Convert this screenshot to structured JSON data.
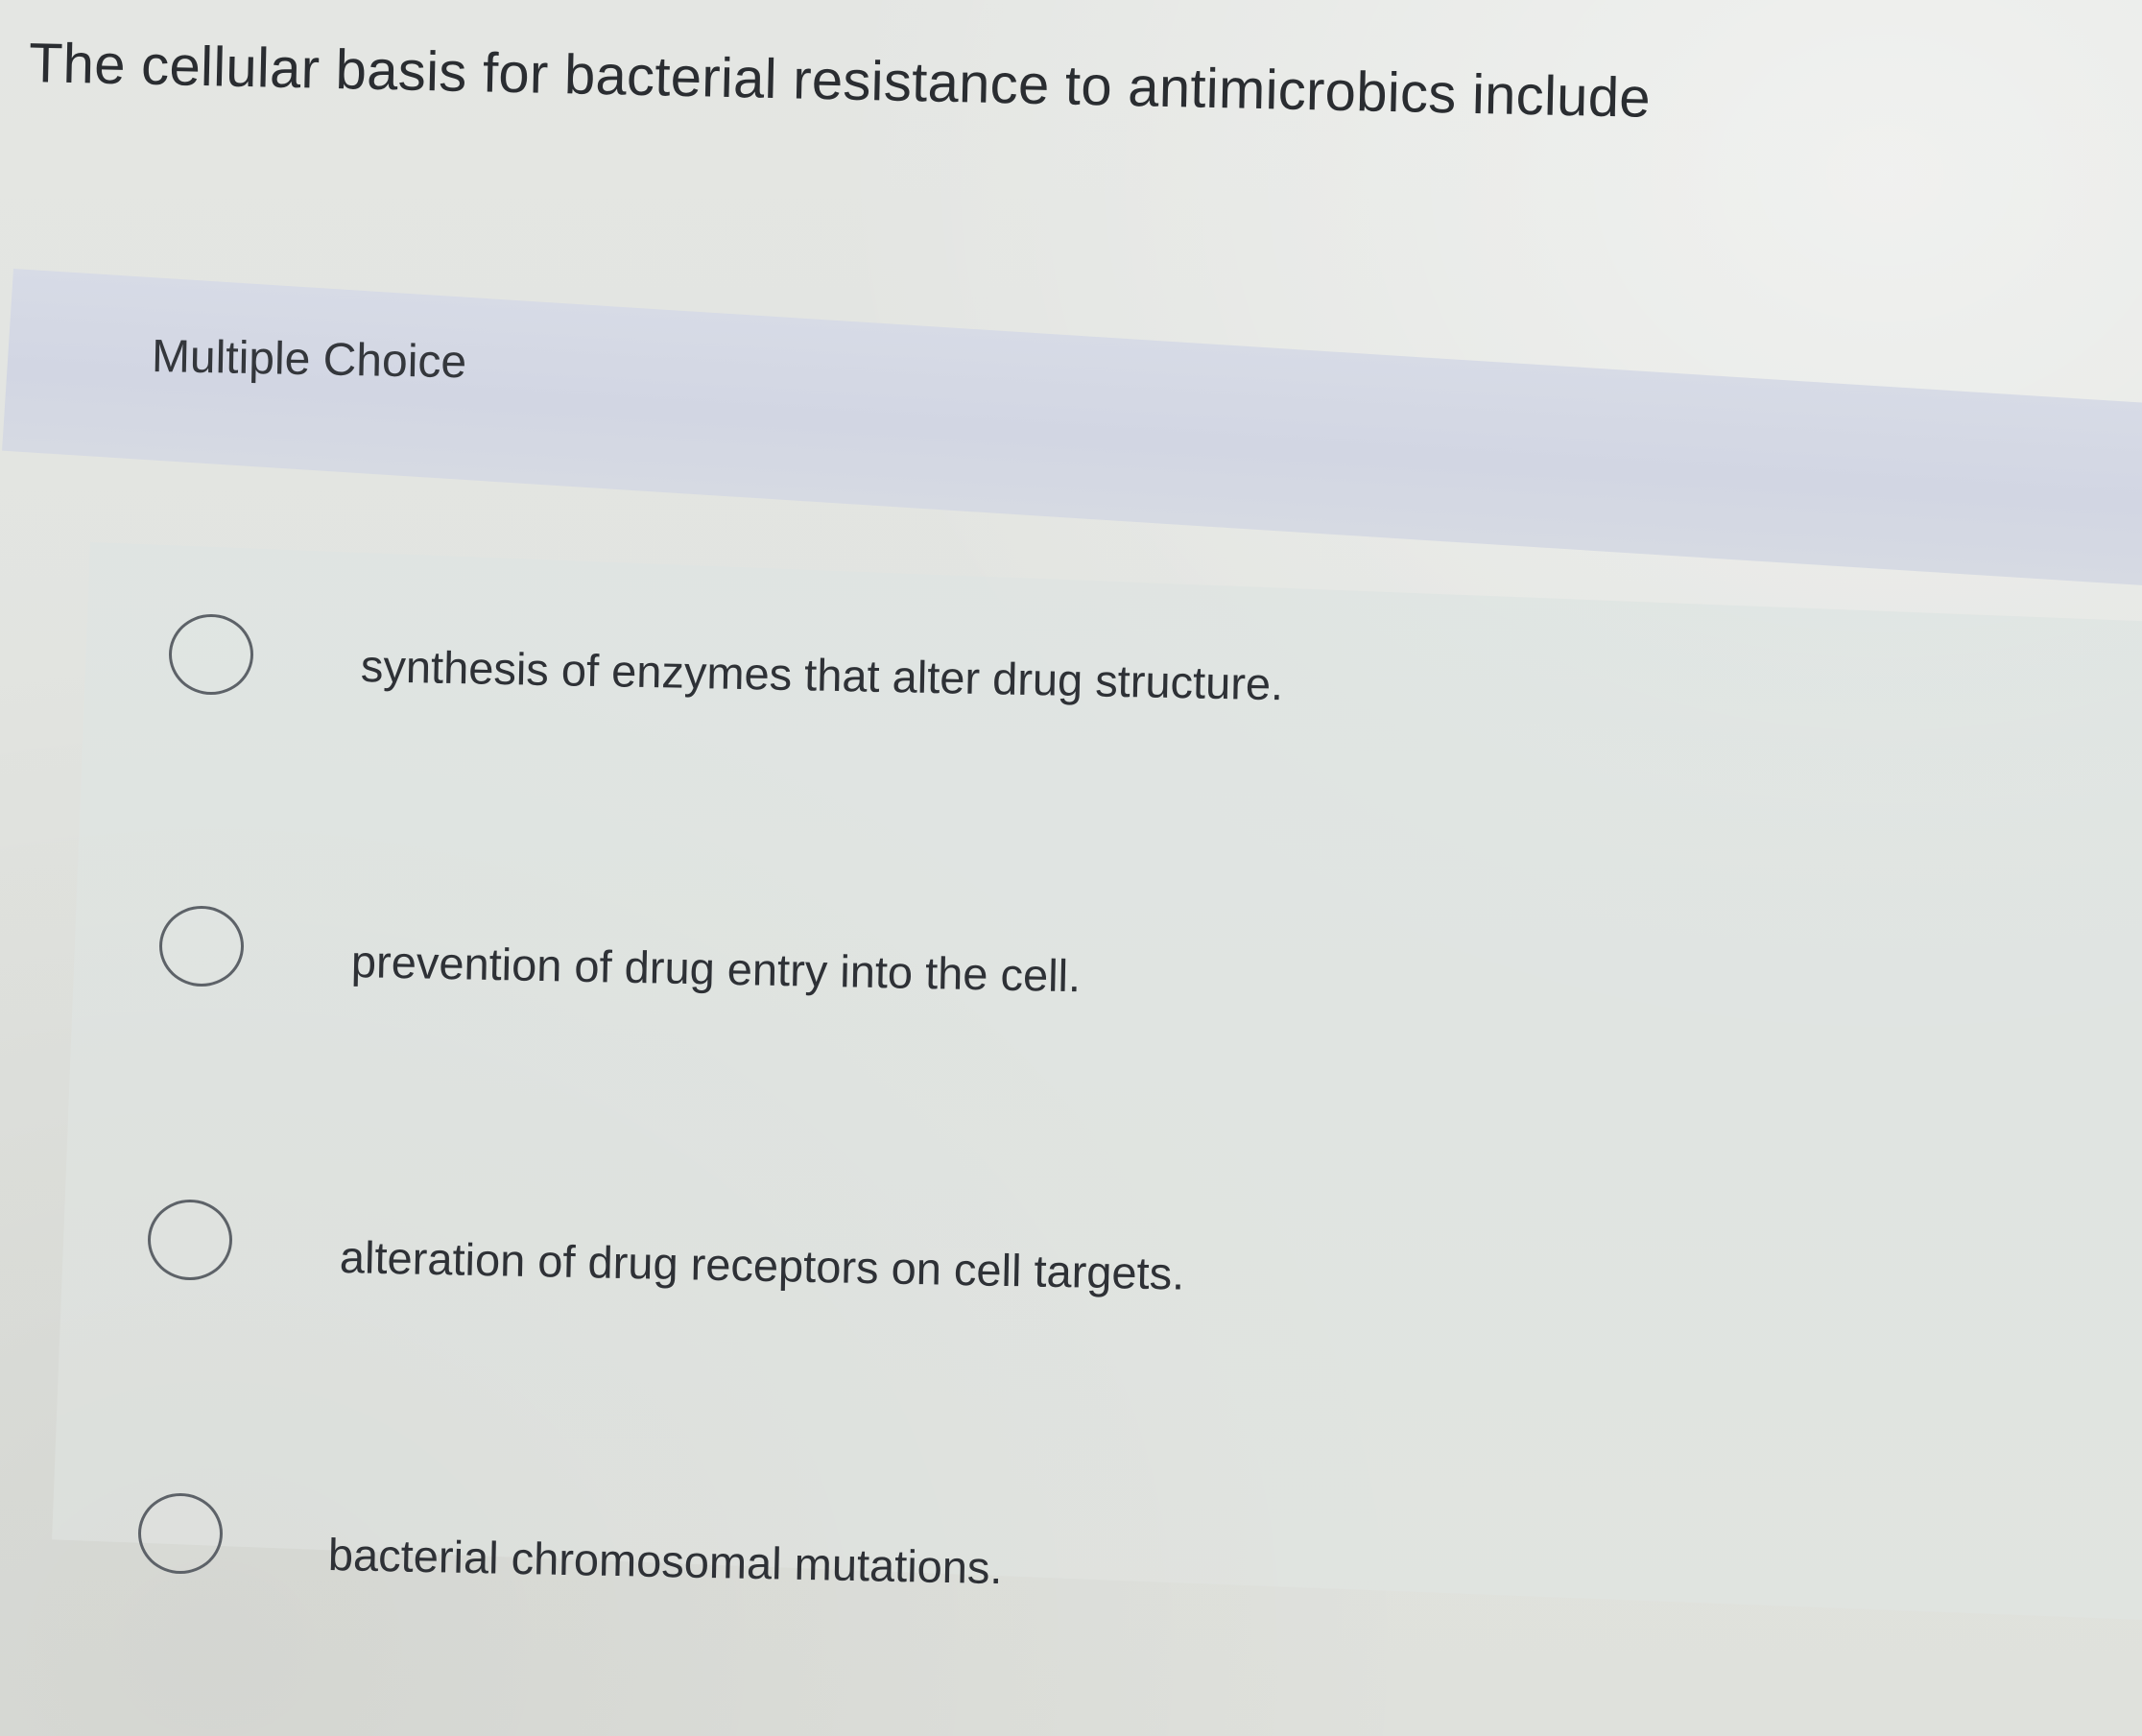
{
  "question": {
    "text": "The cellular basis for bacterial resistance to antimicrobics include"
  },
  "section": {
    "label": "Multiple Choice"
  },
  "choices": [
    {
      "label": "synthesis of enzymes that alter drug structure.",
      "selected": false
    },
    {
      "label": "prevention of drug entry into the cell.",
      "selected": false
    },
    {
      "label": "alteration of drug receptors on cell targets.",
      "selected": false
    },
    {
      "label": "bacterial chromosomal mutations.",
      "selected": false
    }
  ]
}
